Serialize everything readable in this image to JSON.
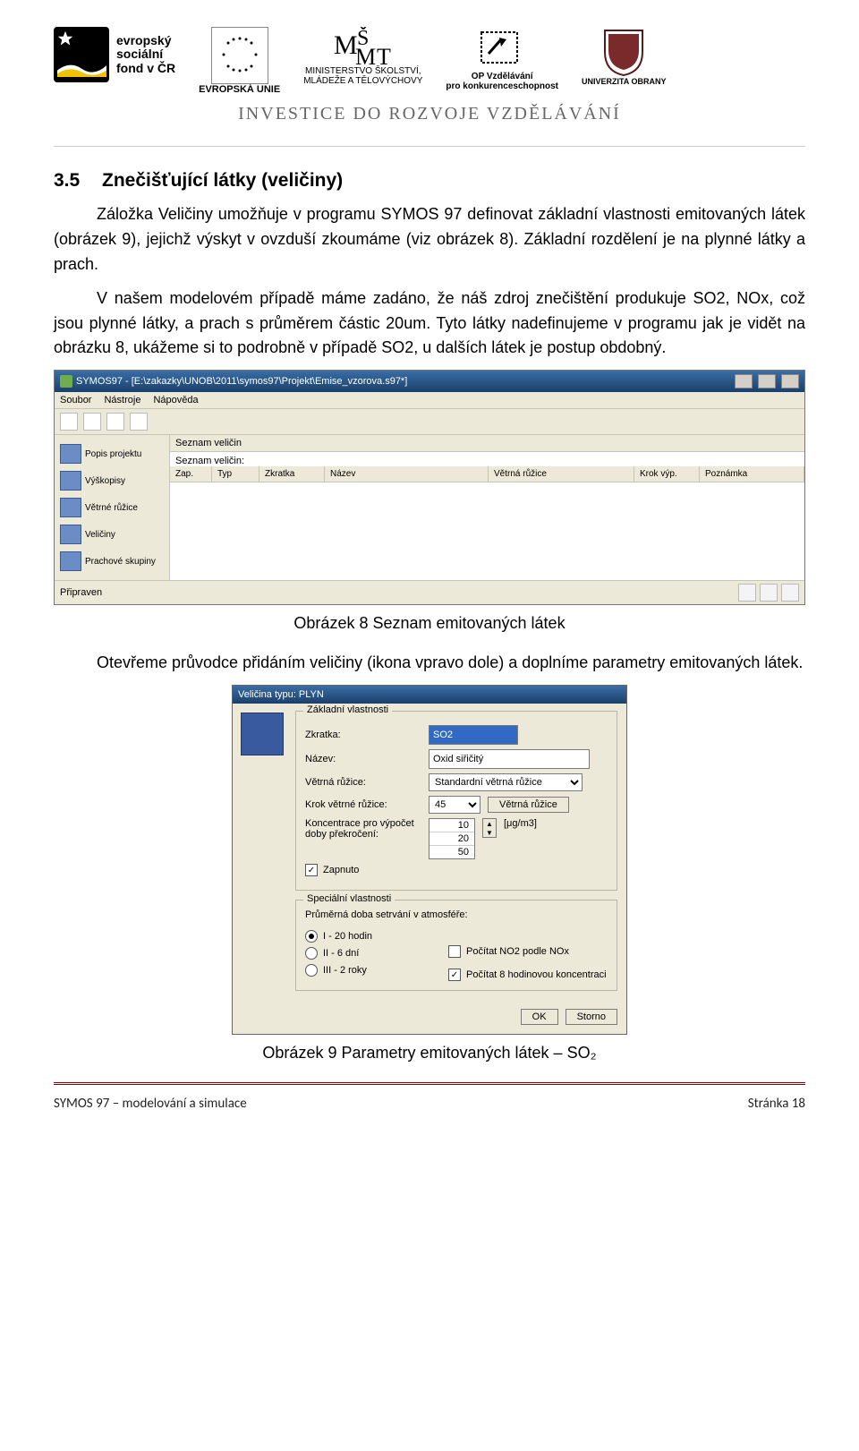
{
  "header": {
    "esf_line1": "evropský",
    "esf_line2": "sociální",
    "esf_line3": "fond v ČR",
    "eu_label": "EVROPSKÁ UNIE",
    "msmt_l1": "MINISTERSTVO ŠKOLSTVÍ,",
    "msmt_l2": "MLÁDEŽE A TĚLOVÝCHOVY",
    "op_l1": "OP Vzdělávání",
    "op_l2": "pro konkurenceschopnost",
    "uo_label": "UNIVERZITA OBRANY",
    "invest": "INVESTICE DO ROZVOJE VZDĚLÁVÁNÍ"
  },
  "section": {
    "num": "3.5",
    "title": "Znečišťující látky (veličiny)"
  },
  "para1": "Záložka Veličiny umožňuje v programu SYMOS 97 definovat základní vlastnosti emitovaných látek (obrázek 9), jejichž výskyt v ovzduší zkoumáme (viz obrázek 8). Základní rozdělení je na plynné látky a prach.",
  "para2": "V našem modelovém případě máme zadáno, že náš zdroj znečištění produkuje SO2, NOx, což jsou plynné látky, a prach s průměrem částic 20um. Tyto látky nadefinujeme v programu jak je vidět na obrázku 8, ukážeme si to podrobně v případě SO2, u dalších látek je postup obdobný.",
  "caption1": "Obrázek 8 Seznam emitovaných látek",
  "para3": "Otevřeme průvodce přidáním veličiny (ikona vpravo dole) a doplníme parametry emitovaných látek.",
  "caption2": "Obrázek 9 Parametry emitovaných látek – SO₂",
  "shot1": {
    "title": "SYMOS97 - [E:\\zakazky\\UNOB\\2011\\symos97\\Projekt\\Emise_vzorova.s97*]",
    "menu": {
      "m0": "Soubor",
      "m1": "Nástroje",
      "m2": "Nápověda"
    },
    "side": {
      "s0": "Popis projektu",
      "s1": "Výškopisy",
      "s2": "Větrné růžice",
      "s3": "Veličiny",
      "s4": "Prachové skupiny"
    },
    "panel_head": "Seznam veličin",
    "list_label": "Seznam veličin:",
    "cols": {
      "c0": "Zap.",
      "c1": "Typ",
      "c2": "Zkratka",
      "c3": "Název",
      "c4": "Větrná růžice",
      "c5": "Krok výp.",
      "c6": "Poznámka"
    },
    "status": "Připraven"
  },
  "dialog": {
    "title": "Veličina typu: PLYN",
    "grp1": "Základní vlastnosti",
    "lbl_zkratka": "Zkratka:",
    "val_zkratka": "SO2",
    "lbl_nazev": "Název:",
    "val_nazev": "Oxid siřičitý",
    "lbl_ruz": "Větrná růžice:",
    "val_ruz": "Standardní větrná růžice",
    "lbl_krok": "Krok větrné růžice:",
    "val_krok": "45",
    "btn_ruz": "Větrná růžice",
    "lbl_konc": "Koncentrace pro výpočet doby překročení:",
    "konc0": "10",
    "konc1": "20",
    "konc2": "50",
    "unit": "[μg/m3]",
    "chk_zap": "Zapnuto",
    "grp2": "Speciální vlastnosti",
    "lbl_setrv": "Průměrná doba setrvání v atmosféře:",
    "r0": "I - 20 hodin",
    "r1": "II - 6 dní",
    "r2": "III - 2 roky",
    "chk_no2": "Počítat NO2 podle NOx",
    "chk_8h": "Počítat 8 hodinovou koncentraci",
    "ok": "OK",
    "storno": "Storno"
  },
  "footer": {
    "left": "SYMOS 97 – modelování a simulace",
    "right": "Stránka 18"
  }
}
